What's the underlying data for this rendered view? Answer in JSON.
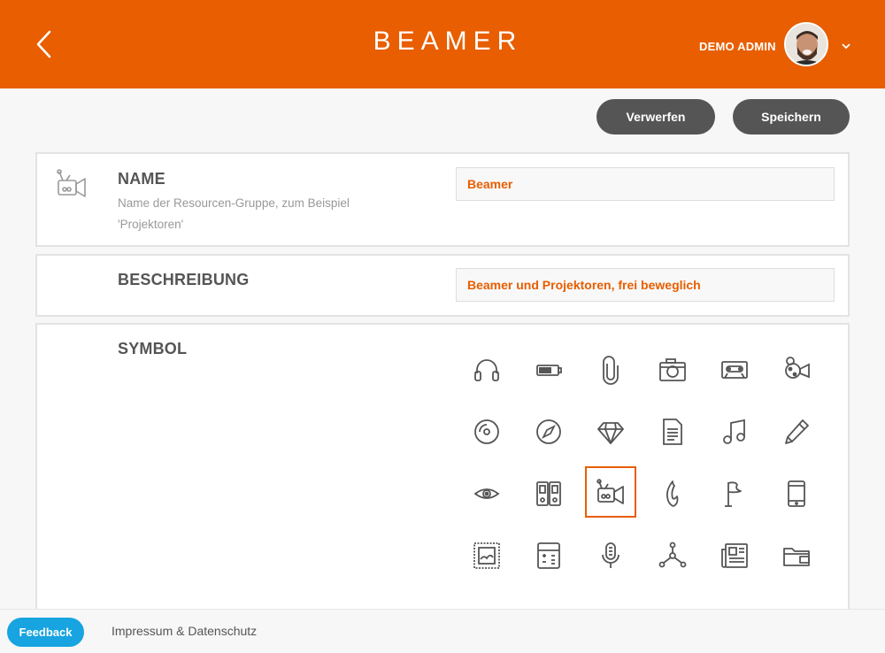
{
  "header": {
    "logo": "BEAMER",
    "user_name": "DEMO ADMIN",
    "background_color": "#e85e00",
    "back_icon": "chevron-left-icon",
    "menu_icon": "chevron-down-icon"
  },
  "actions": {
    "discard_label": "Verwerfen",
    "save_label": "Speichern"
  },
  "name_section": {
    "title": "NAME",
    "hint": "Name der Resourcen-Gruppe, zum Beispiel 'Projektoren'",
    "value": "Beamer",
    "icon": "projector-icon"
  },
  "description_section": {
    "title": "BESCHREIBUNG",
    "value": "Beamer und Projektoren, frei beweglich"
  },
  "symbol_section": {
    "title": "SYMBOL",
    "selected": "projector",
    "icons": [
      "headphones",
      "battery",
      "paperclip",
      "camera",
      "cassette",
      "film-camera",
      "disc",
      "compass",
      "diamond",
      "document",
      "music-note",
      "pencil",
      "eye",
      "binders",
      "projector",
      "flame",
      "flag",
      "smartphone",
      "stamp",
      "calculator",
      "microphone",
      "network",
      "newspaper",
      "folder"
    ]
  },
  "footer": {
    "feedback_label": "Feedback",
    "impressum_label": "Impressum & Datenschutz"
  },
  "colors": {
    "accent": "#e85e00",
    "button": "#555555",
    "feedback": "#17a4e0"
  }
}
